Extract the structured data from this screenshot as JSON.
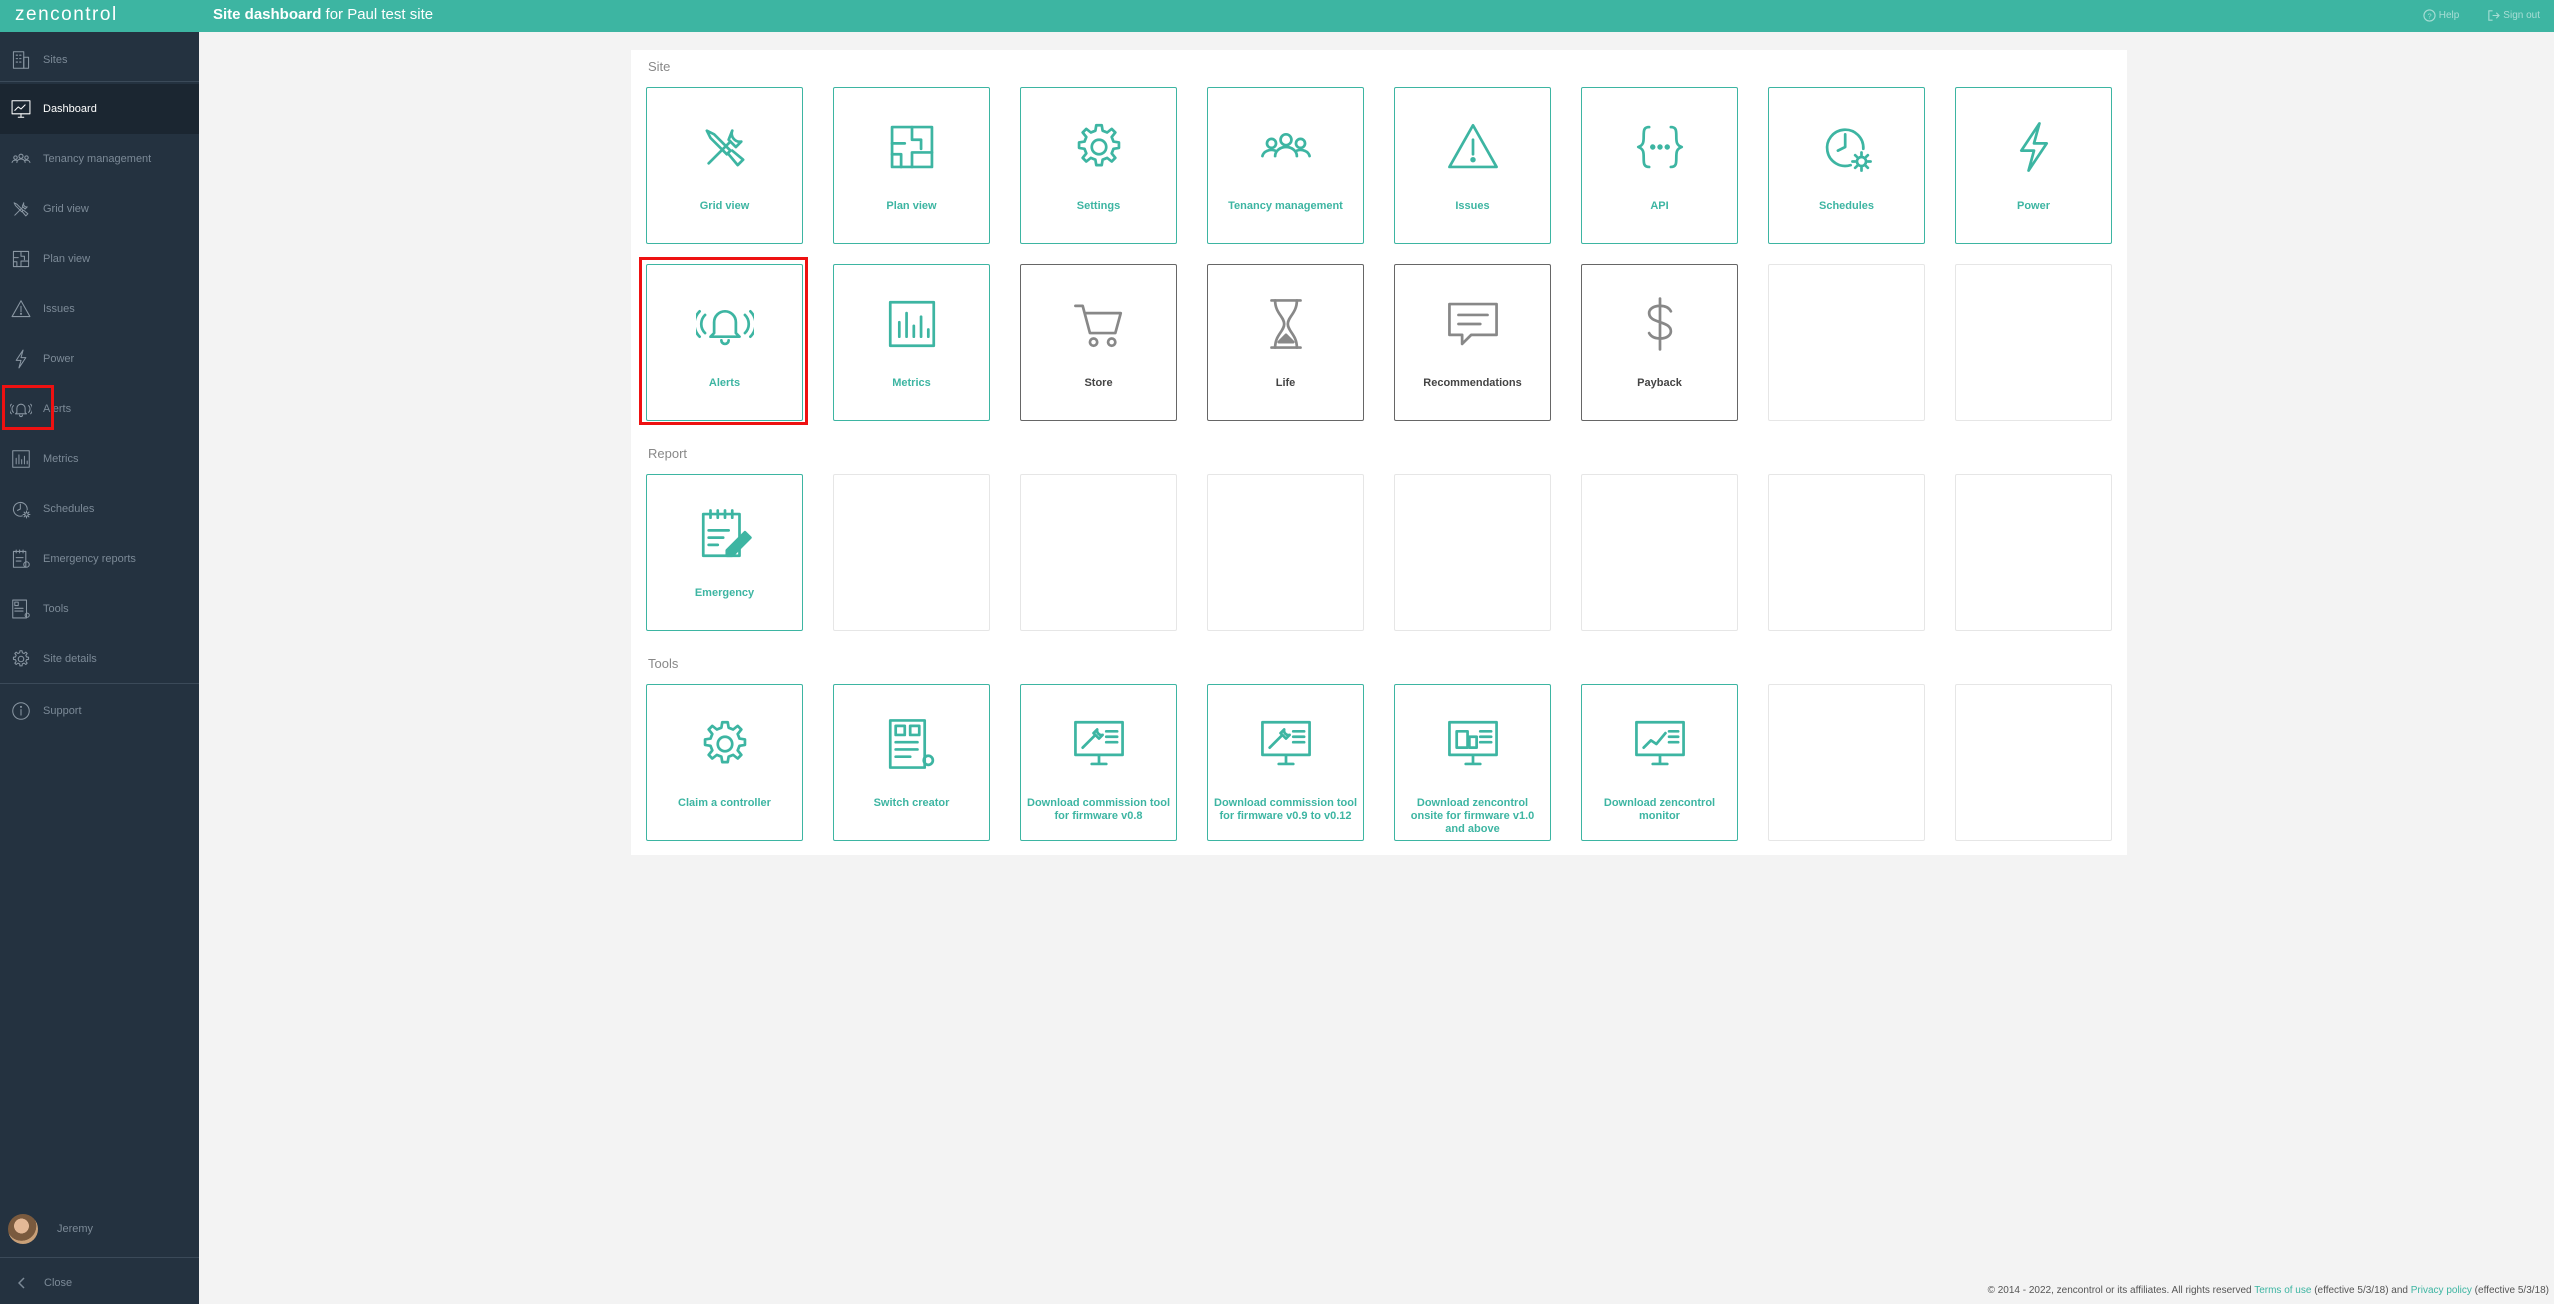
{
  "app": {
    "logo": "zencontrol",
    "title_bold": "Site dashboard",
    "title_rest": " for Paul test site"
  },
  "top": {
    "help": "Help",
    "sign_out": "Sign out"
  },
  "sidebar": {
    "items": [
      {
        "label": "Sites",
        "icon": "building-icon"
      },
      {
        "label": "Dashboard",
        "icon": "dashboard-icon"
      },
      {
        "label": "Tenancy management",
        "icon": "people-icon"
      },
      {
        "label": "Grid view",
        "icon": "tools-icon"
      },
      {
        "label": "Plan view",
        "icon": "plan-icon"
      },
      {
        "label": "Issues",
        "icon": "warning-icon"
      },
      {
        "label": "Power",
        "icon": "bolt-icon"
      },
      {
        "label": "Alerts",
        "icon": "bell-icon"
      },
      {
        "label": "Metrics",
        "icon": "chart-icon"
      },
      {
        "label": "Schedules",
        "icon": "clock-gear-icon"
      },
      {
        "label": "Emergency reports",
        "icon": "report-icon"
      },
      {
        "label": "Tools",
        "icon": "toolbox-icon"
      },
      {
        "label": "Site details",
        "icon": "gear-icon"
      },
      {
        "label": "Support",
        "icon": "info-icon"
      }
    ],
    "user": "Jeremy",
    "close": "Close"
  },
  "sections": {
    "site": "Site",
    "report": "Report",
    "tools": "Tools"
  },
  "tiles": {
    "site_row1": [
      {
        "label": "Grid view",
        "icon": "tools-icon"
      },
      {
        "label": "Plan view",
        "icon": "plan-icon"
      },
      {
        "label": "Settings",
        "icon": "gear-icon"
      },
      {
        "label": "Tenancy management",
        "icon": "people-icon"
      },
      {
        "label": "Issues",
        "icon": "warning-icon"
      },
      {
        "label": "API",
        "icon": "api-icon"
      },
      {
        "label": "Schedules",
        "icon": "clock-gear-icon"
      },
      {
        "label": "Power",
        "icon": "bolt-icon"
      }
    ],
    "site_row2": [
      {
        "label": "Alerts",
        "icon": "bell-icon"
      },
      {
        "label": "Metrics",
        "icon": "chart-icon"
      },
      {
        "label": "Store",
        "icon": "cart-icon"
      },
      {
        "label": "Life",
        "icon": "hourglass-icon"
      },
      {
        "label": "Recommendations",
        "icon": "comment-icon"
      },
      {
        "label": "Payback",
        "icon": "dollar-icon"
      }
    ],
    "report": [
      {
        "label": "Emergency",
        "icon": "emergency-report-icon"
      }
    ],
    "tools": [
      {
        "label": "Claim a controller",
        "icon": "gear-icon"
      },
      {
        "label": "Switch creator",
        "icon": "switch-creator-icon"
      },
      {
        "label": "Download commission tool for firmware v0.8",
        "icon": "monitor-tool-icon"
      },
      {
        "label": "Download commission tool for firmware v0.9 to v0.12",
        "icon": "monitor-tool-icon"
      },
      {
        "label": "Download zencontrol onsite for firmware v1.0 and above",
        "icon": "monitor-building-icon"
      },
      {
        "label": "Download zencontrol monitor",
        "icon": "monitor-chart-icon"
      }
    ]
  },
  "footer": {
    "copyright": "© 2014 - 2022, zencontrol or its affiliates. All rights reserved ",
    "terms": "Terms of use",
    "terms_eff": " (effective 5/3/18) and ",
    "privacy": "Privacy policy",
    "privacy_eff": " (effective 5/3/18)"
  },
  "colors": {
    "accent": "#3db5a2",
    "sidebar": "#243240",
    "highlight": "#ee1111"
  }
}
